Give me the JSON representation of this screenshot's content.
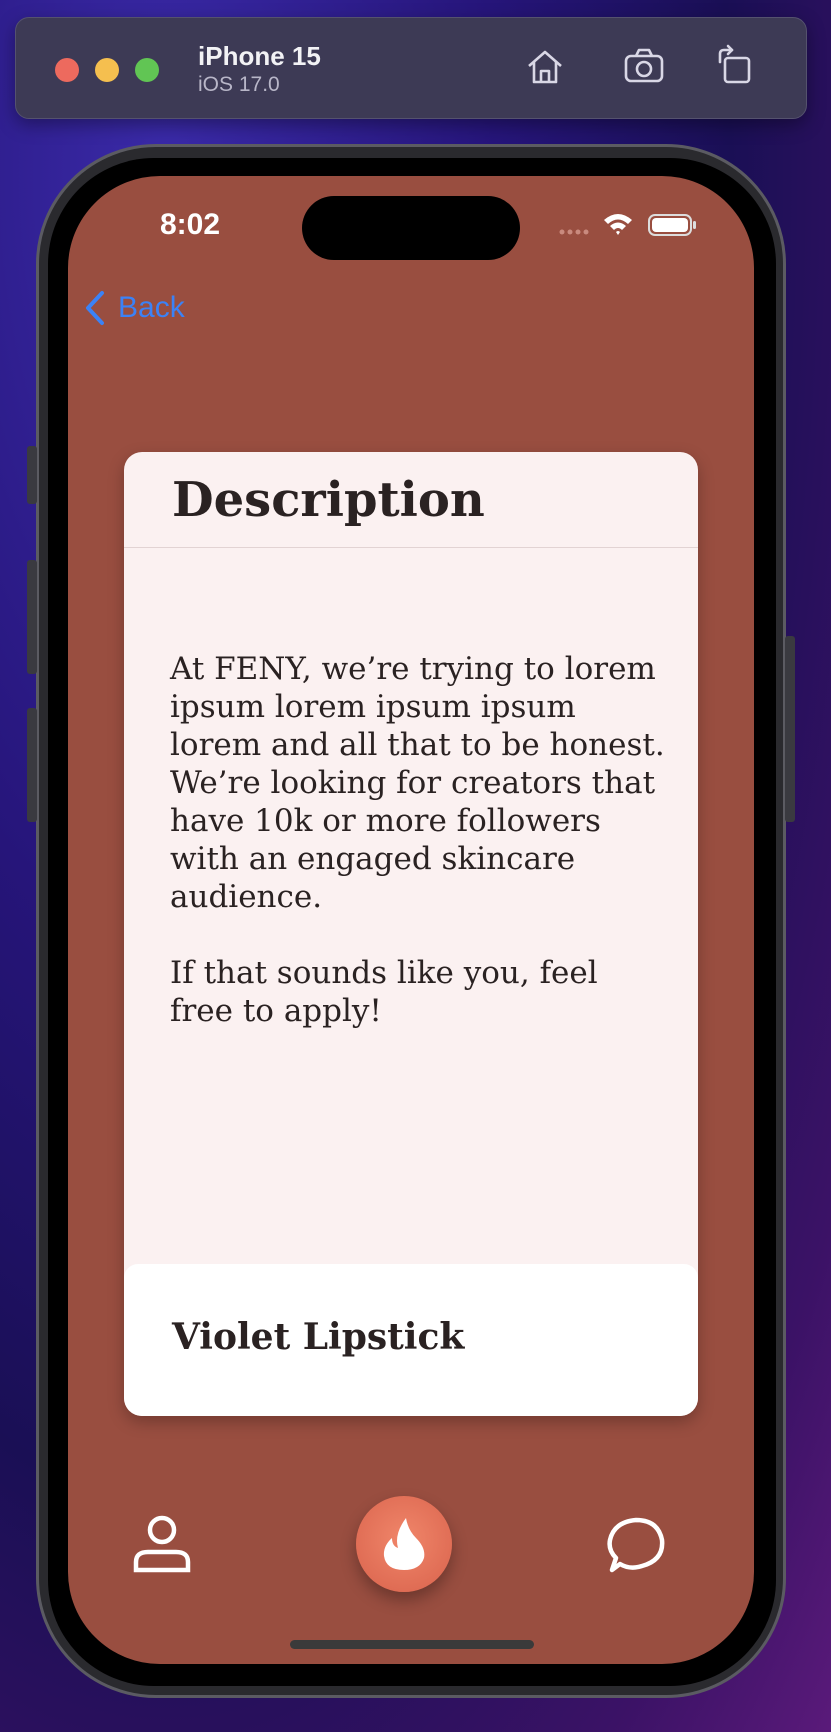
{
  "simulator": {
    "device_name": "iPhone 15",
    "os_version": "iOS 17.0",
    "toolbar_icons": [
      "home-icon",
      "screenshot-icon",
      "rotate-icon"
    ]
  },
  "status_bar": {
    "time": "8:02",
    "icons": [
      "signal-icon",
      "wifi-icon",
      "battery-icon"
    ]
  },
  "nav": {
    "back_label": "Back"
  },
  "card": {
    "title": "Description",
    "paragraphs": [
      "At FENY, we’re trying to lorem ipsum lorem ipsum ipsum lorem and all that to be honest.  We’re looking for creators that have 10k or more followers with an engaged skincare audience.",
      "If that sounds like you, feel free to apply!"
    ],
    "product_name": "Violet Lipstick"
  },
  "tab_bar": {
    "items": [
      "profile-icon",
      "flame-icon",
      "chat-icon"
    ]
  },
  "colors": {
    "screen_background": "#994e40",
    "card_background": "#fbf1f1",
    "accent": "#e06d55",
    "link": "#3b82f6"
  }
}
